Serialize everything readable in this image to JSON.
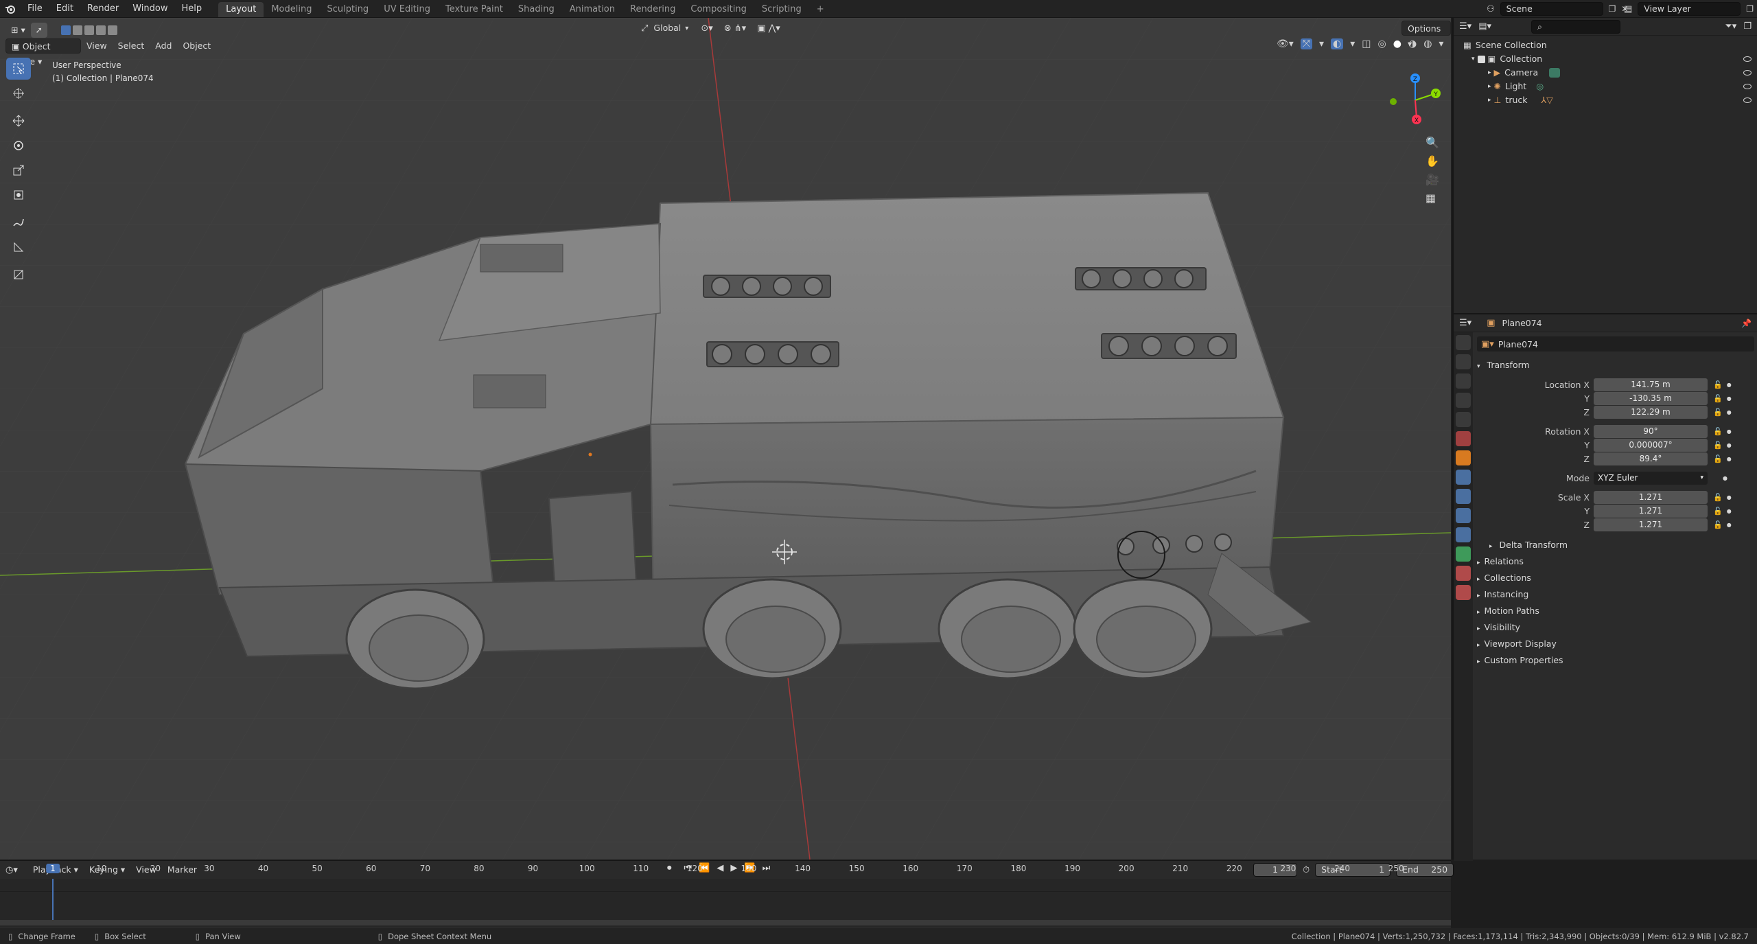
{
  "topbar": {
    "menus": [
      "File",
      "Edit",
      "Render",
      "Window",
      "Help"
    ],
    "workspaces": [
      "Layout",
      "Modeling",
      "Sculpting",
      "UV Editing",
      "Texture Paint",
      "Shading",
      "Animation",
      "Rendering",
      "Compositing",
      "Scripting"
    ],
    "active_workspace": "Layout",
    "add_workspace": "+",
    "scene_name": "Scene",
    "view_layer": "View Layer"
  },
  "viewport": {
    "mode": "Object Mode",
    "menus": [
      "View",
      "Select",
      "Add",
      "Object"
    ],
    "orientation": "Global",
    "options": "Options",
    "overlay_title": "User Perspective",
    "overlay_subtitle": "(1) Collection | Plane074",
    "gizmo_axes": {
      "x": "X",
      "y": "Y",
      "z": "Z"
    }
  },
  "outliner": {
    "root": "Scene Collection",
    "items": [
      {
        "label": "Collection",
        "indent": 1
      },
      {
        "label": "Camera",
        "indent": 2
      },
      {
        "label": "Light",
        "indent": 2
      },
      {
        "label": "truck",
        "indent": 2
      }
    ]
  },
  "properties": {
    "object_name": "Plane074",
    "datablock_name": "Plane074",
    "transform_header": "Transform",
    "location": {
      "label": "Location X",
      "x": "141.75 m",
      "y": "-130.35 m",
      "z": "122.29 m"
    },
    "rotation": {
      "label": "Rotation X",
      "x": "90°",
      "y": "0.000007°",
      "z": "89.4°"
    },
    "mode_label": "Mode",
    "mode_value": "XYZ Euler",
    "scale": {
      "label": "Scale X",
      "x": "1.271",
      "y": "1.271",
      "z": "1.271"
    },
    "axis_y": "Y",
    "axis_z": "Z",
    "sub_panels": [
      "Delta Transform"
    ],
    "panels": [
      "Relations",
      "Collections",
      "Instancing",
      "Motion Paths",
      "Visibility",
      "Viewport Display",
      "Custom Properties"
    ]
  },
  "timeline": {
    "menus": [
      "Playback",
      "Keying",
      "View",
      "Marker"
    ],
    "current_frame": "1",
    "start_label": "Start",
    "start": "1",
    "end_label": "End",
    "end": "250",
    "ruler": [
      "1",
      "10",
      "20",
      "30",
      "40",
      "50",
      "60",
      "70",
      "80",
      "90",
      "100",
      "110",
      "120",
      "130",
      "140",
      "150",
      "160",
      "170",
      "180",
      "190",
      "200",
      "210",
      "220",
      "230",
      "240",
      "250"
    ]
  },
  "statusbar": {
    "hints": [
      "Change Frame",
      "Box Select",
      "Pan View",
      "Dope Sheet Context Menu"
    ],
    "stats": "Collection | Plane074 | Verts:1,250,732 | Faces:1,173,114 | Tris:2,343,990 | Objects:0/39 | Mem: 612.9 MiB | v2.82.7"
  },
  "colors": {
    "accent": "#4772b3",
    "x_axis": "#ff3352",
    "y_axis": "#8bdc00",
    "z_axis": "#2890ff",
    "viewport_bg": "#3d3d3d"
  }
}
